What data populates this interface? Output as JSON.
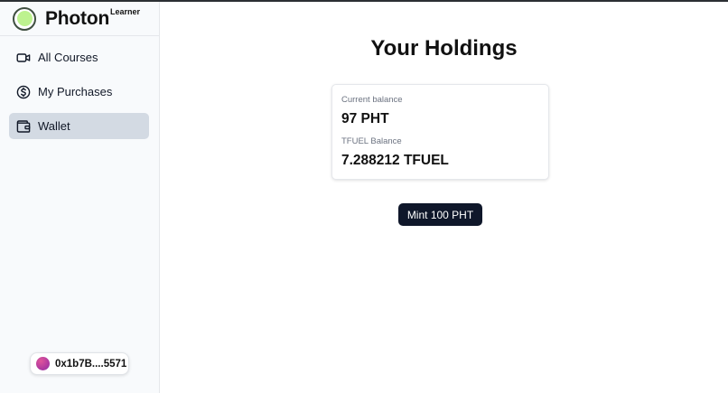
{
  "brand": {
    "name": "Photon",
    "tag": "Learner"
  },
  "sidebar": {
    "items": [
      {
        "label": "All Courses",
        "icon": "video-camera-icon"
      },
      {
        "label": "My Purchases",
        "icon": "dollar-circle-icon"
      },
      {
        "label": "Wallet",
        "icon": "wallet-icon",
        "active": true
      }
    ]
  },
  "wallet": {
    "address": "0x1b7B....5571"
  },
  "main": {
    "title": "Your Holdings",
    "balances": [
      {
        "label": "Current balance",
        "value": "97 PHT"
      },
      {
        "label": "TFUEL Balance",
        "value": "7.288212 TFUEL"
      }
    ],
    "mint_label": "Mint 100 PHT"
  },
  "colors": {
    "sidebar_bg": "#f8fafc",
    "active_item_bg": "#d3dae3",
    "logo_fill": "#bdf28f",
    "button_bg": "#0f172a"
  }
}
